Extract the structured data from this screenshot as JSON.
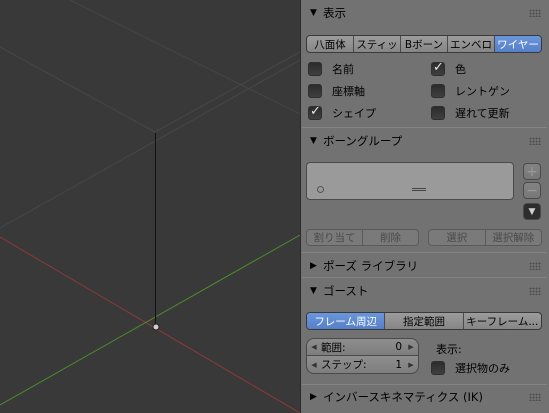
{
  "viewport": {
    "grid_color": "#4a4a4a",
    "x_axis_color": "#8a3a3a",
    "y_axis_color": "#4d8a2d",
    "bone_color": "#111111"
  },
  "display_panel": {
    "title": "表示",
    "types": [
      {
        "label": "八面体",
        "active": false
      },
      {
        "label": "スティッ",
        "active": false
      },
      {
        "label": "Bボーン",
        "active": false
      },
      {
        "label": "エンベロ",
        "active": false
      },
      {
        "label": "ワイヤー",
        "active": true
      }
    ],
    "checks": [
      {
        "label": "名前",
        "checked": false
      },
      {
        "label": "色",
        "checked": true
      },
      {
        "label": "座標軸",
        "checked": false
      },
      {
        "label": "レントゲン",
        "checked": false
      },
      {
        "label": "シェイプ",
        "checked": true
      },
      {
        "label": "遅れて更新",
        "checked": false
      }
    ]
  },
  "bone_groups_panel": {
    "title": "ボーングループ",
    "buttons": [
      "割り当て",
      "削除",
      "選択",
      "選択解除"
    ],
    "add_icon": "+",
    "remove_icon": "−",
    "menu_icon": "▼"
  },
  "pose_library_panel": {
    "title": "ポーズ ライブラリ"
  },
  "ghost_panel": {
    "title": "ゴースト",
    "modes": [
      {
        "label": "フレーム周辺",
        "active": true
      },
      {
        "label": "指定範囲",
        "active": false
      },
      {
        "label": "キーフレーム...",
        "active": false
      }
    ],
    "range_label": "範囲:",
    "range_value": "0",
    "step_label": "ステップ:",
    "step_value": "1",
    "display_label": "表示:",
    "selected_only_label": "選択物のみ",
    "selected_only_checked": false
  },
  "ik_panel": {
    "title": "インバースキネマティクス (IK)"
  },
  "icons": {
    "expanded": "▼",
    "collapsed": "▶",
    "check": "✓"
  },
  "accent_color": "#5a85cc"
}
